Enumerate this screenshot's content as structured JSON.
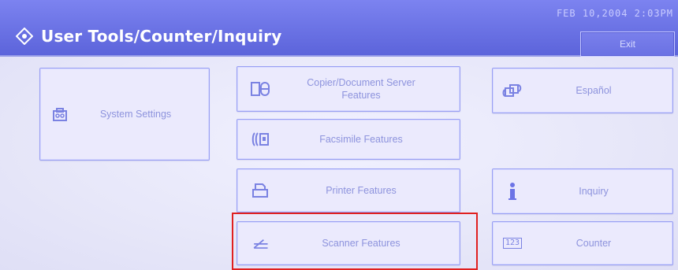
{
  "header": {
    "title": "User Tools/Counter/Inquiry",
    "datetime": "FEB  10,2004  2:03PM",
    "exit_label": "Exit"
  },
  "buttons": {
    "system_settings": "System Settings",
    "copier_document_server": "Copier/Document Server\nFeatures",
    "facsimile": "Facsimile Features",
    "printer": "Printer Features",
    "scanner": "Scanner Features",
    "espanol": "Español",
    "inquiry": "Inquiry",
    "counter": "Counter"
  },
  "icons": {
    "user_tools": "user-tools-icon",
    "system_settings": "toolbox-icon",
    "copier": "copier-icon",
    "fax": "fax-icon",
    "printer": "printer-icon",
    "scanner": "scanner-icon",
    "language": "language-icon",
    "inquiry": "info-icon",
    "counter": "counter-icon",
    "counter_text": "123"
  },
  "colors": {
    "header_bg": "#6d73e6",
    "tile_bg": "#ebeafd",
    "tile_border": "#9aa0f3",
    "highlight": "#e02020"
  }
}
